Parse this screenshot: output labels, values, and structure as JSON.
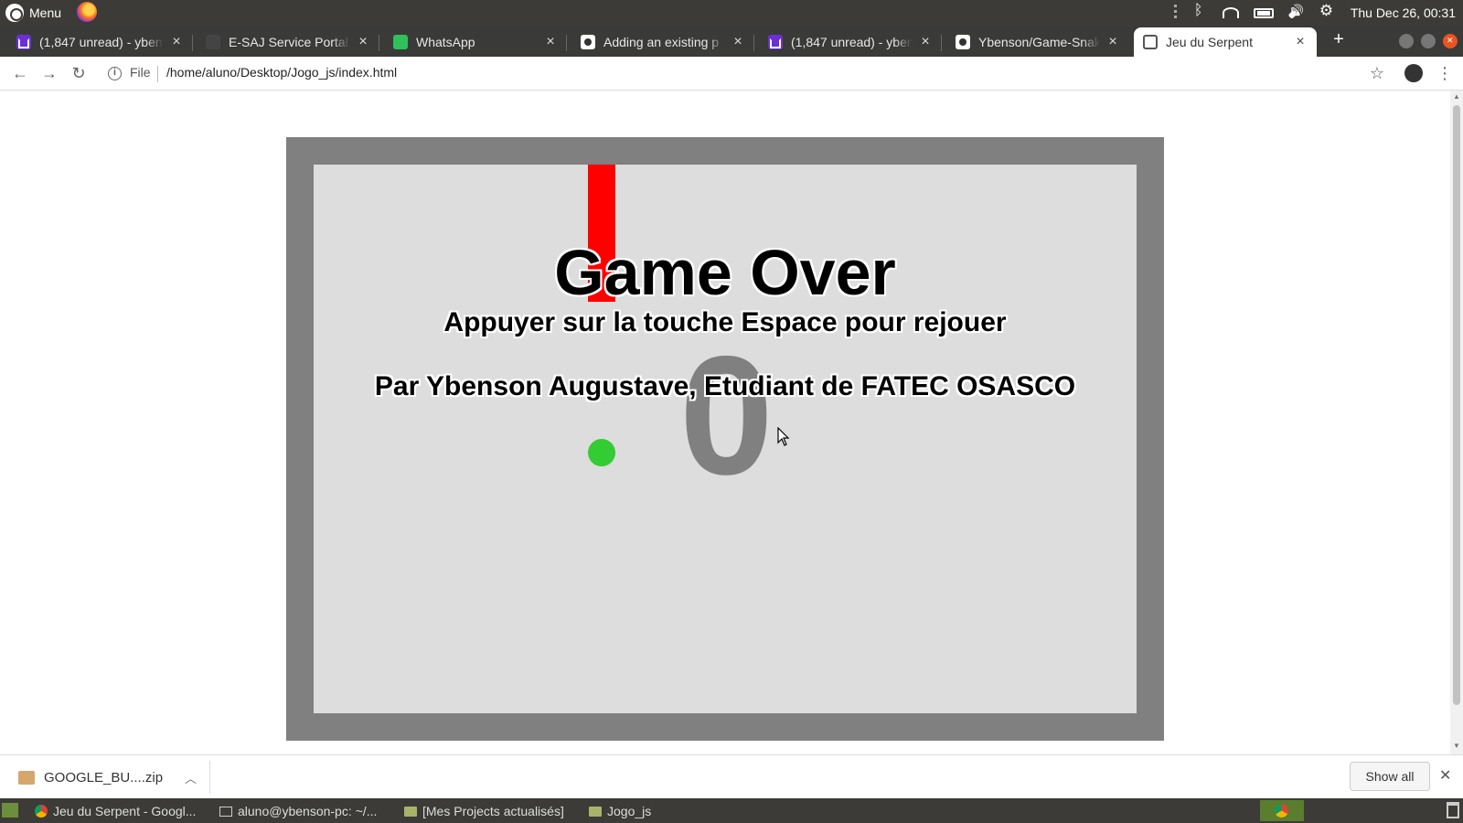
{
  "system_panel": {
    "menu_label": "Menu",
    "clock": "Thu Dec 26, 00:31"
  },
  "tabs": [
    {
      "title": "(1,847 unread) - yben",
      "icon": "mail-icon",
      "active": false
    },
    {
      "title": "E-SAJ Service Portal",
      "icon": "blank-icon",
      "active": false
    },
    {
      "title": "WhatsApp",
      "icon": "whatsapp-icon",
      "active": false
    },
    {
      "title": "Adding an existing p",
      "icon": "github-icon",
      "active": false
    },
    {
      "title": "(1,847 unread) - yben",
      "icon": "mail-icon",
      "active": false
    },
    {
      "title": "Ybenson/Game-Snak",
      "icon": "github-icon",
      "active": false
    },
    {
      "title": "Jeu du Serpent",
      "icon": "globe-icon",
      "active": true
    }
  ],
  "address_bar": {
    "scheme_label": "File",
    "url": "/home/aluno/Desktop/Jogo_js/index.html"
  },
  "game": {
    "score": "0",
    "title": "Game Over",
    "restart_prompt": "Appuyer sur la touche Espace pour rejouer",
    "author": "Par Ybenson Augustave, Etudiant de FATEC OSASCO",
    "colors": {
      "frame": "#808080",
      "board": "#dddddd",
      "snake": "#ff0000",
      "apple": "#33cc33",
      "score": "#808080"
    }
  },
  "download_bar": {
    "file_name": "GOOGLE_BU....zip",
    "show_all_label": "Show all"
  },
  "taskbar": {
    "items": [
      {
        "label": "Jeu du Serpent - Googl...",
        "icon": "chrome-icon"
      },
      {
        "label": "aluno@ybenson-pc: ~/...",
        "icon": "terminal-icon"
      },
      {
        "label": "[Mes Projects actualisés]",
        "icon": "folder-icon"
      },
      {
        "label": "Jogo_js",
        "icon": "folder-icon"
      }
    ]
  }
}
